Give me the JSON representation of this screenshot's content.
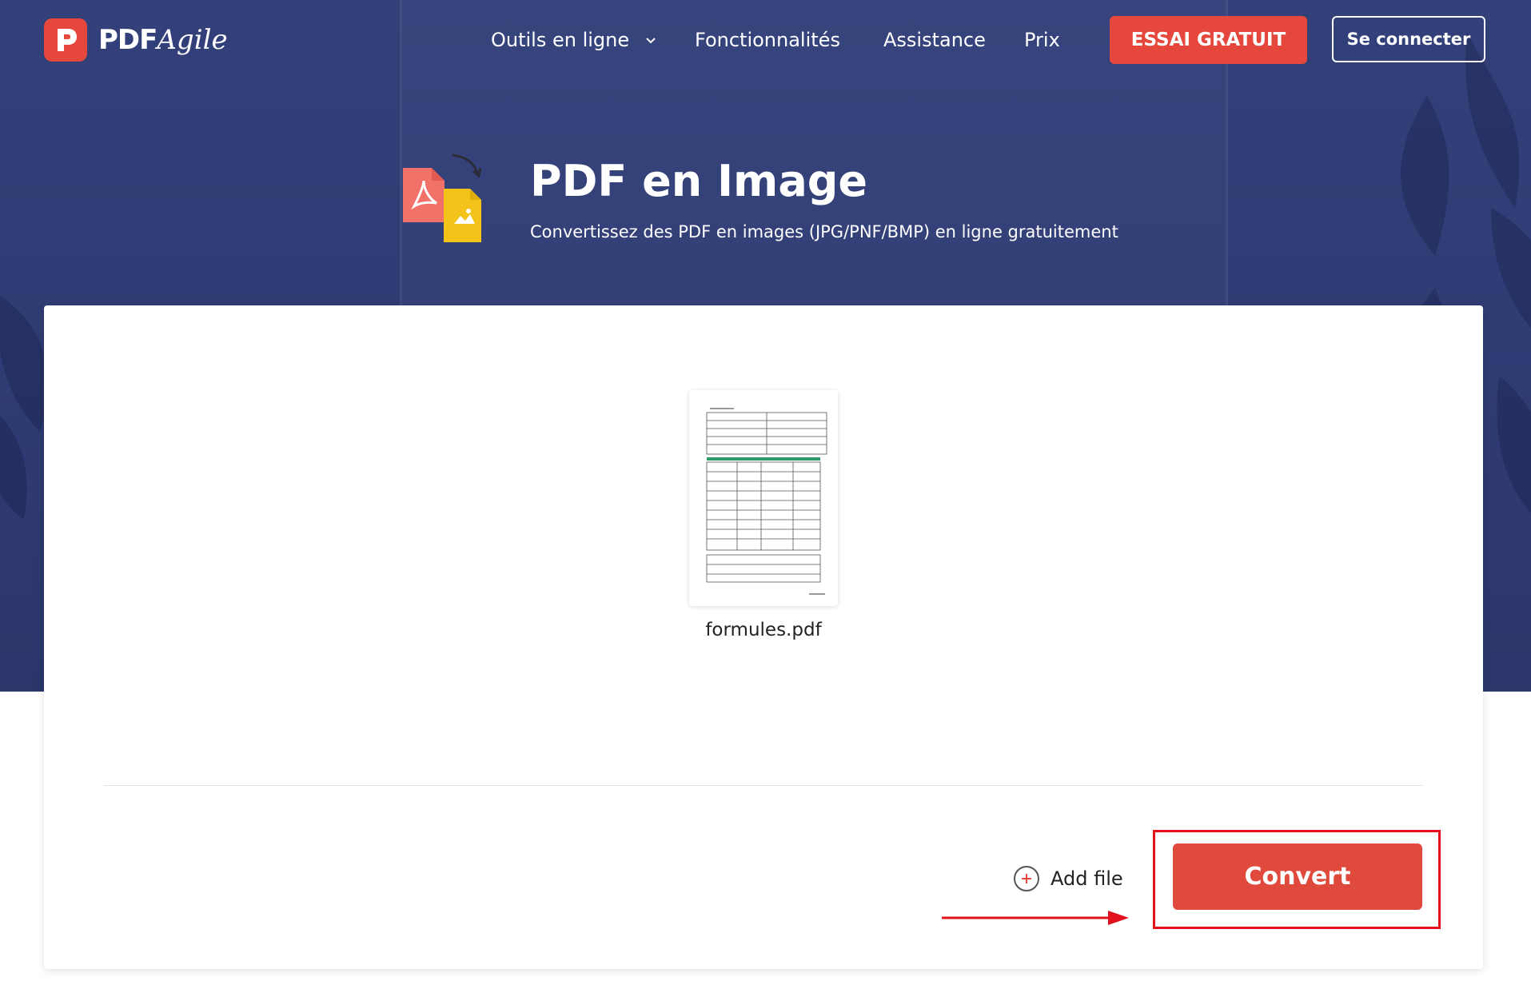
{
  "header": {
    "logo_text": "PDF",
    "logo_script": "Agile",
    "nav": [
      {
        "label": "Outils en ligne",
        "has_dropdown": true
      },
      {
        "label": "Fonctionnalités"
      },
      {
        "label": "Assistance"
      },
      {
        "label": "Prix"
      }
    ],
    "trial_button": "ESSAI GRATUIT",
    "login_button": "Se connecter"
  },
  "hero": {
    "title": "PDF en Image",
    "subtitle": "Convertissez des PDF en images (JPG/PNF/BMP) en ligne gratuitement"
  },
  "upload": {
    "file_name": "formules.pdf",
    "add_file_label": "Add file",
    "convert_label": "Convert"
  },
  "colors": {
    "brand": "#e5473c",
    "hero_bg": "#2f3b73",
    "annotation": "#e2111c"
  },
  "icons": {
    "logo": "pdf-agile-logo-icon",
    "tool": "pdf-to-image-icon",
    "dropdown": "chevron-down-icon",
    "add": "plus-circle-icon"
  }
}
